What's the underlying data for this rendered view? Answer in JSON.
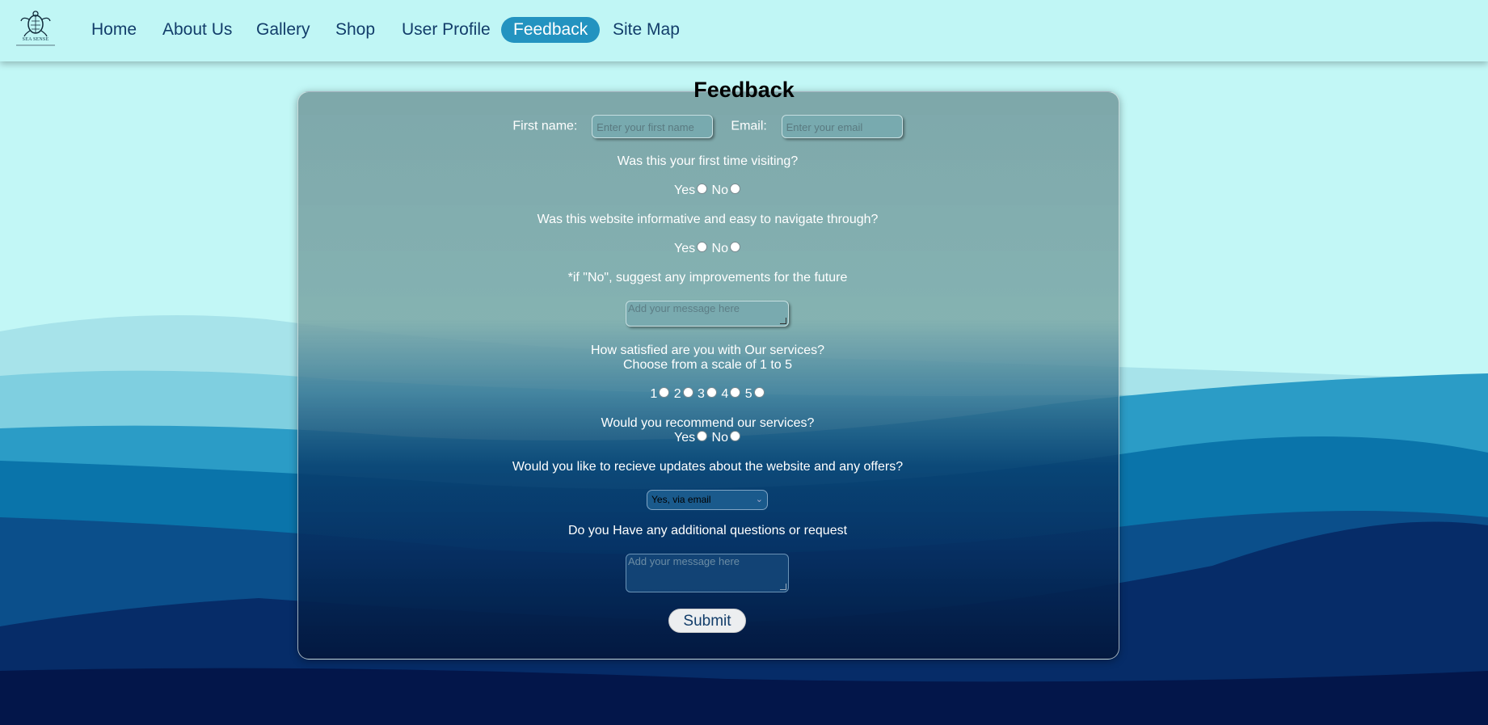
{
  "nav": {
    "logo_text": "SEA SENSE",
    "items": [
      {
        "label": "Home"
      },
      {
        "label": "About Us"
      },
      {
        "label": "Gallery"
      },
      {
        "label": "Shop"
      },
      {
        "label": "User Profile"
      },
      {
        "label": "Feedback",
        "active": true
      },
      {
        "label": "Site Map"
      }
    ]
  },
  "form": {
    "title": "Feedback",
    "first_name_label": "First name:",
    "first_name_placeholder": "Enter your first name",
    "email_label": "Email:",
    "email_placeholder": "Enter your email",
    "q1": "Was this your first time visiting?",
    "q2": "Was this website informative and easy to navigate through?",
    "q3": "*if \"No\", suggest any improvements for the future",
    "improvements_placeholder": "Add your message here",
    "q4_line1": "How satisfied are you with Our services?",
    "q4_line2": "Choose from a scale of 1 to 5",
    "scale": [
      "1",
      "2",
      "3",
      "4",
      "5"
    ],
    "q5": "Would you recommend our services?",
    "q6": "Would you like to recieve updates about the website and any offers?",
    "updates_selected": "Yes, via email",
    "q7": "Do you Have any additional questions or request",
    "additional_placeholder": "Add your message here",
    "yes_label": "Yes",
    "no_label": "No",
    "submit_label": "Submit"
  },
  "colors": {
    "nav_bg": "#c0f6f5",
    "active_tab": "#2393c0",
    "nav_text": "#123d6a"
  }
}
